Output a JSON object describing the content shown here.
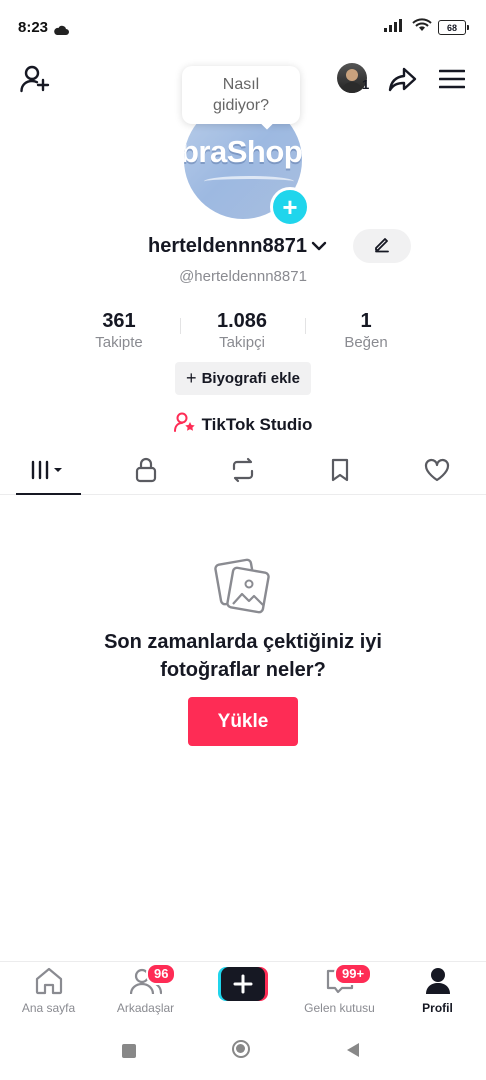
{
  "status": {
    "time": "8:23",
    "battery": "68"
  },
  "bubble": {
    "line1": "Nasıl",
    "line2": "gidiyor?"
  },
  "header": {
    "notification_count": "1"
  },
  "avatar": {
    "text": "braShop"
  },
  "profile": {
    "username": "herteldennn8871",
    "handle": "@herteldennn8871"
  },
  "stats": [
    {
      "value": "361",
      "label": "Takipte"
    },
    {
      "value": "1.086",
      "label": "Takipçi"
    },
    {
      "value": "1",
      "label": "Beğen"
    }
  ],
  "bio_button": {
    "label": "Biyografi ekle"
  },
  "studio": {
    "label": "TikTok Studio"
  },
  "empty": {
    "line1": "Son zamanlarda çektiğiniz iyi",
    "line2": "fotoğraflar neler?",
    "button": "Yükle"
  },
  "nav": {
    "home": "Ana sayfa",
    "friends": "Arkadaşlar",
    "friends_badge": "96",
    "inbox": "Gelen kutusu",
    "inbox_badge": "99+",
    "profile": "Profil"
  },
  "colors": {
    "accent": "#fe2c55",
    "cyan": "#20d5ec",
    "text": "#161823",
    "muted": "#8a8b91"
  }
}
